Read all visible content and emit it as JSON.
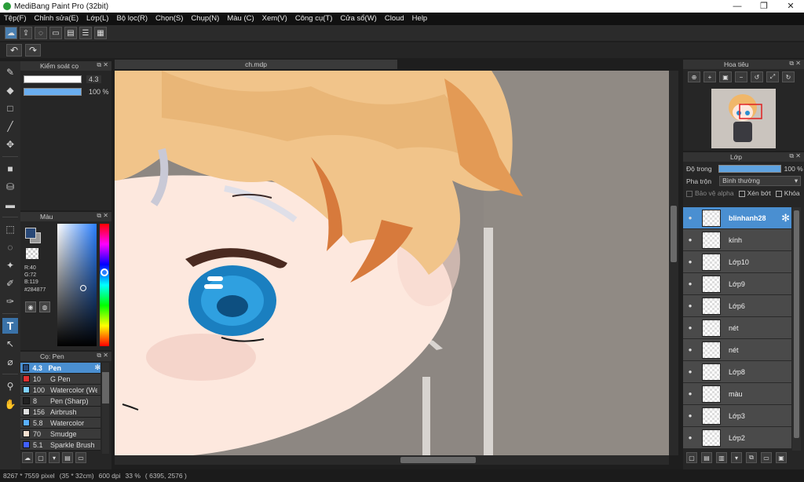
{
  "window": {
    "title": "MediBang Paint Pro (32bit)",
    "controls": [
      "—",
      "❐",
      "✕"
    ]
  },
  "menu": [
    "Tệp(F)",
    "Chỉnh sửa(E)",
    "Lớp(L)",
    "Bộ lọc(R)",
    "Chọn(S)",
    "Chụp(N)",
    "Màu (C)",
    "Xem(V)",
    "Công cụ(T)",
    "Cửa sổ(W)",
    "Cloud",
    "Help"
  ],
  "brush_control": {
    "title": "Kiểm soát cọ",
    "size_value": "4.3",
    "opacity_value": "100 %",
    "size_fill": 1.0,
    "opacity_fill": 1.0
  },
  "color_panel": {
    "title": "Màu",
    "r": "R:40",
    "g": "G:72",
    "b": "B:119",
    "hex": "#284877",
    "fg_color": "#284877"
  },
  "brush_panel": {
    "title": "Cọ: Pen",
    "items": [
      {
        "size": "4.3",
        "name": "Pen",
        "color": "#284877",
        "active": true
      },
      {
        "size": "10",
        "name": "G Pen",
        "color": "#e03030"
      },
      {
        "size": "100",
        "name": "Watercolor (We",
        "color": "#7fd0ff"
      },
      {
        "size": "8",
        "name": "Pen (Sharp)",
        "color": "#222222"
      },
      {
        "size": "156",
        "name": "Airbrush",
        "color": "#e0e0e0"
      },
      {
        "size": "5.8",
        "name": "Watercolor",
        "color": "#5ab0ff"
      },
      {
        "size": "70",
        "name": "Smudge",
        "color": "#f4e0d0"
      },
      {
        "size": "5.1",
        "name": "Sparkle Brush",
        "color": "#4060ff"
      }
    ]
  },
  "canvas": {
    "tab_title": "ch.mdp"
  },
  "status": {
    "size": "8267 * 7559 pixel",
    "cm": "(35 * 32cm)",
    "dpi": "600 dpi",
    "zoom": "33 %",
    "coords": "( 6395, 2576 )"
  },
  "navigator": {
    "title": "Hoa tiêu"
  },
  "layers": {
    "title": "Lớp",
    "opacity_label": "Độ trong",
    "opacity_value": "100 %",
    "blend_label": "Pha trộn",
    "blend_value": "Bình thường",
    "protect_alpha": "Bảo vệ alpha",
    "clip": "Xén bớt",
    "lock": "Khóa",
    "items": [
      {
        "name": "blinhanh28",
        "active": true
      },
      {
        "name": "kính"
      },
      {
        "name": "Lớp10"
      },
      {
        "name": "Lớp9"
      },
      {
        "name": "Lớp6"
      },
      {
        "name": "nét"
      },
      {
        "name": "nét"
      },
      {
        "name": "Lớp8"
      },
      {
        "name": "màu"
      },
      {
        "name": "Lớp3"
      },
      {
        "name": "Lớp2"
      }
    ]
  }
}
